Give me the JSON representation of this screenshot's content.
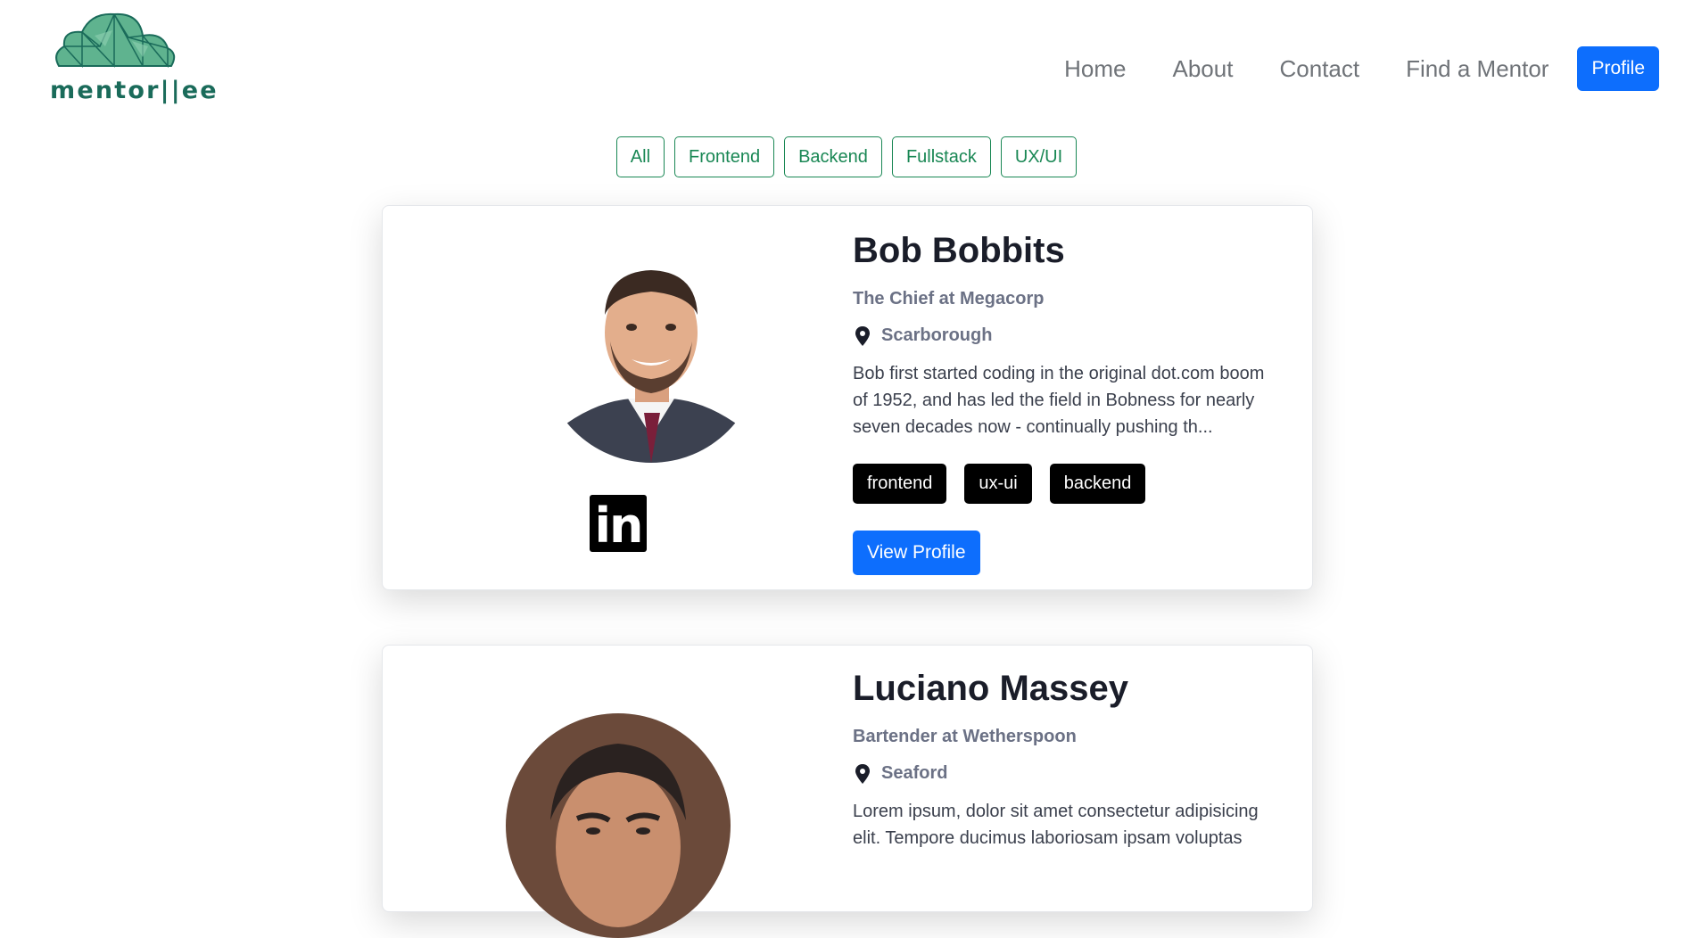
{
  "brand": {
    "logo_text": "mentor||ee",
    "accent_color": "#1a6b5a",
    "leaf_color": "#5fb38f"
  },
  "nav": {
    "links": [
      "Home",
      "About",
      "Contact",
      "Find a Mentor"
    ],
    "profile_label": "Profile"
  },
  "filters": [
    "All",
    "Frontend",
    "Backend",
    "Fullstack",
    "UX/UI"
  ],
  "mentors": [
    {
      "name": "Bob Bobbits",
      "title": "The Chief at Megacorp",
      "location": "Scarborough",
      "bio": "Bob first started coding in the original dot.com boom of 1952, and has led the field in Bobness for nearly seven decades now - continually pushing th...",
      "tags": [
        "frontend",
        "ux-ui",
        "backend"
      ],
      "linkedin_icon": "linkedin-icon",
      "view_label": "View Profile"
    },
    {
      "name": "Luciano Massey",
      "title": "Bartender at Wetherspoon",
      "location": "Seaford",
      "bio": "Lorem ipsum, dolor sit amet consectetur adipisicing elit. Tempore ducimus laboriosam ipsam voluptas"
    }
  ],
  "colors": {
    "primary": "#0d6efd",
    "filter_green": "#198754",
    "tag_bg": "#000000"
  }
}
